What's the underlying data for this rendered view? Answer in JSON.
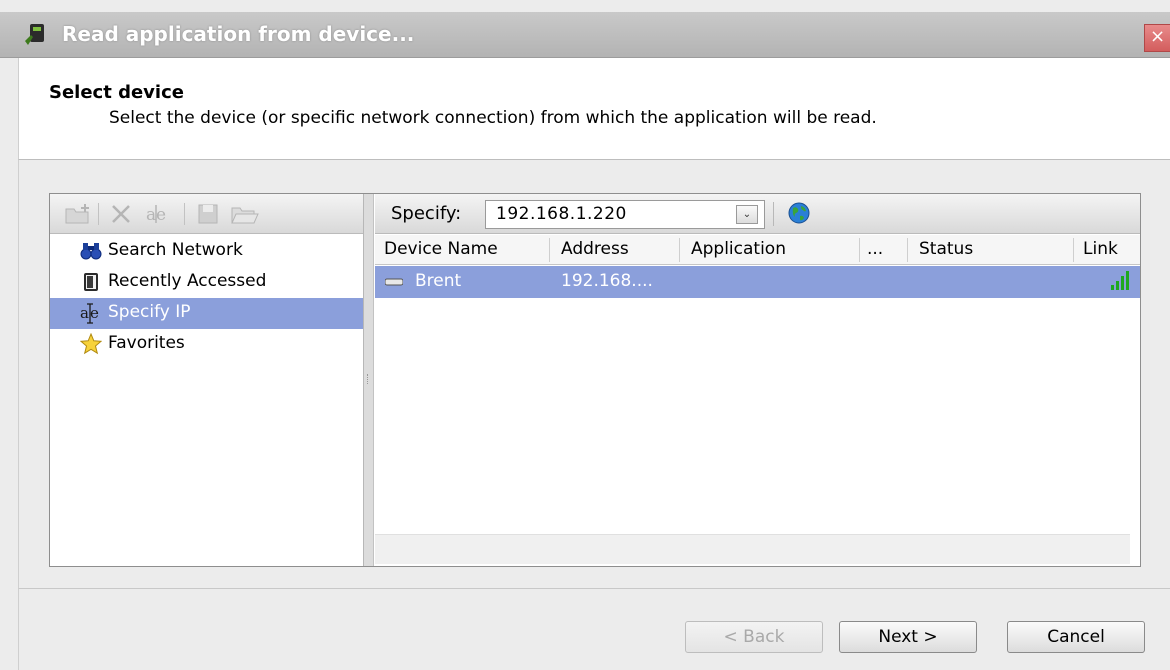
{
  "window": {
    "title": "Read application from device...",
    "close_label": "×"
  },
  "header": {
    "title": "Select device",
    "description": "Select the device (or specific network connection) from which the application will be read."
  },
  "left_toolbar": {
    "icons": [
      "new-folder-icon",
      "delete-icon",
      "specify-ip-icon",
      "save-icon",
      "open-folder-icon"
    ]
  },
  "nav": {
    "items": [
      {
        "label": "Search Network",
        "icon": "binoculars-icon",
        "selected": false
      },
      {
        "label": "Recently Accessed",
        "icon": "recent-device-icon",
        "selected": false
      },
      {
        "label": "Specify IP",
        "icon": "specify-ip-icon",
        "selected": true
      },
      {
        "label": "Favorites",
        "icon": "star-icon",
        "selected": false
      }
    ]
  },
  "specify": {
    "label": "Specify:",
    "value": "192.168.1.220"
  },
  "grid": {
    "columns": [
      "Device Name",
      "Address",
      "Application",
      "...",
      "Status",
      "Link"
    ],
    "rows": [
      {
        "device_name": "Brent",
        "address": "192.168....",
        "application": "",
        "more": "",
        "status": "",
        "link": "signal-strong-icon",
        "selected": true
      }
    ]
  },
  "footer": {
    "back_label": "< Back",
    "next_label": "Next >",
    "cancel_label": "Cancel"
  },
  "colors": {
    "selection": "#8b9fdb",
    "title_bar": "#bdbdbd",
    "close_button": "#d35d5d",
    "signal_green": "#1fa81f"
  }
}
